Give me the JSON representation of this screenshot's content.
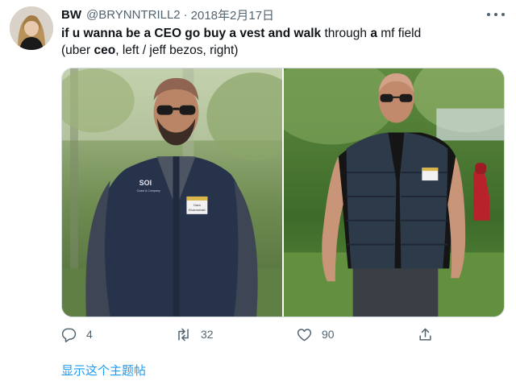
{
  "tweet": {
    "display_name": "BW",
    "handle": "@BRYNNTRILL2",
    "separator": "·",
    "timestamp": "2018年2月17日",
    "text": {
      "part1": "if u wanna be a CEO go buy a vest and walk",
      "part2": " through ",
      "part3": "a",
      "part4": " mf field",
      "part5": "(uber ",
      "part6": "ceo",
      "part7": ", left / jeff bezos, right)"
    },
    "media": {
      "left_badge_line1": "Dara",
      "left_badge_line2": "Khosrowshahi",
      "left_logo": "SOI",
      "left_logo_sub": "Coast & Company"
    },
    "actions": {
      "reply_count": "4",
      "retweet_count": "32",
      "like_count": "90"
    },
    "show_thread": "显示这个主题帖"
  },
  "colors": {
    "text": "#0f1419",
    "muted": "#536471",
    "link": "#1d9bf0"
  },
  "icons": [
    "more-icon",
    "reply-icon",
    "retweet-icon",
    "like-icon",
    "share-icon"
  ]
}
